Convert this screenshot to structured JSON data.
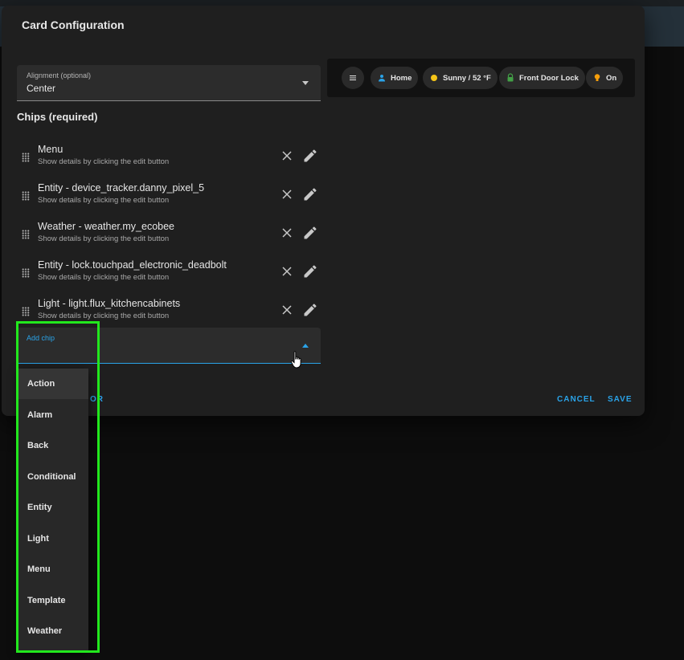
{
  "dialog": {
    "title": "Card Configuration",
    "alignment": {
      "label": "Alignment (optional)",
      "value": "Center"
    },
    "chips_heading": "Chips (required)",
    "chips": [
      {
        "name": "Menu",
        "detail": "Show details by clicking the edit button"
      },
      {
        "name": "Entity - device_tracker.danny_pixel_5",
        "detail": "Show details by clicking the edit button"
      },
      {
        "name": "Weather - weather.my_ecobee",
        "detail": "Show details by clicking the edit button"
      },
      {
        "name": "Entity - lock.touchpad_electronic_deadbolt",
        "detail": "Show details by clicking the edit button"
      },
      {
        "name": "Light - light.flux_kitchencabinets",
        "detail": "Show details by clicking the edit button"
      }
    ],
    "add_chip": {
      "label": "Add chip"
    },
    "editor_fragment": "OR",
    "cancel_label": "CANCEL",
    "save_label": "SAVE"
  },
  "preview": {
    "chips": [
      {
        "icon": "menu-icon",
        "label": ""
      },
      {
        "icon": "person-icon",
        "label": "Home",
        "color": "#2aa3e8"
      },
      {
        "icon": "sun-icon",
        "label": "Sunny / 52 °F",
        "color": "#f5c518"
      },
      {
        "icon": "lock-icon",
        "label": "Front Door Lock",
        "color": "#43a047"
      },
      {
        "icon": "bulb-icon",
        "label": "On",
        "color": "#f59e0b"
      }
    ]
  },
  "dropdown": {
    "options": [
      "Action",
      "Alarm",
      "Back",
      "Conditional",
      "Entity",
      "Light",
      "Menu",
      "Template",
      "Weather"
    ],
    "highlighted": "Action"
  },
  "colors": {
    "accent": "#2aa3e8",
    "annotation": "#22e81d"
  }
}
